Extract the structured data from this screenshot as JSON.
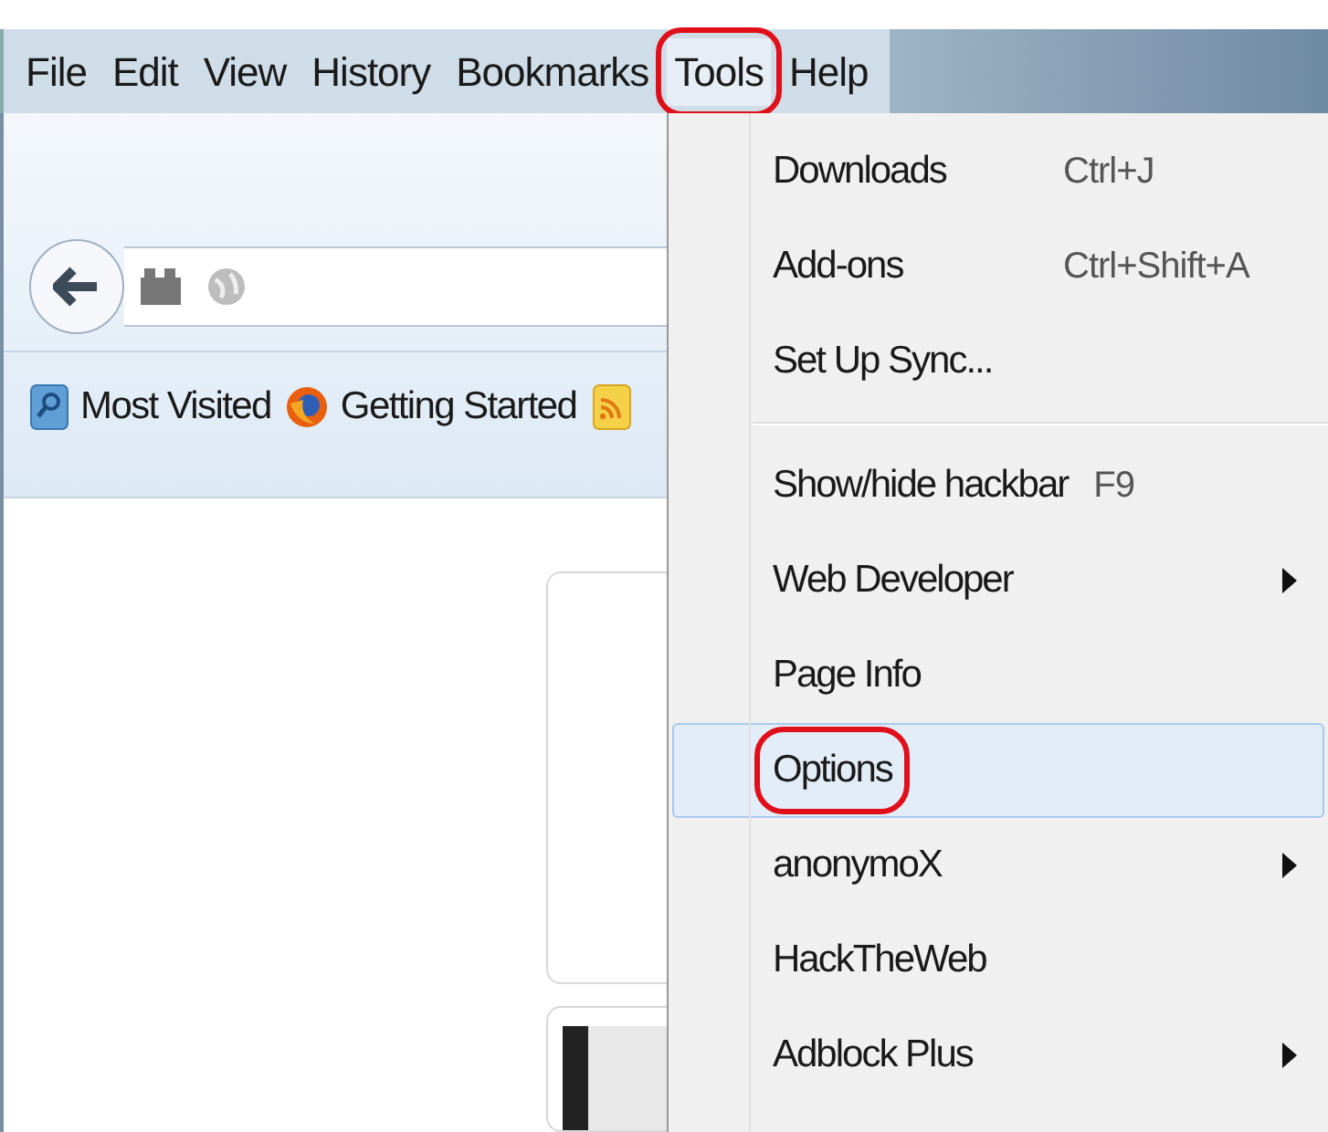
{
  "menu_bar": [
    {
      "label": "File",
      "selected": false,
      "circled": false
    },
    {
      "label": "Edit",
      "selected": false,
      "circled": false
    },
    {
      "label": "View",
      "selected": false,
      "circled": false
    },
    {
      "label": "History",
      "selected": false,
      "circled": false
    },
    {
      "label": "Bookmarks",
      "selected": false,
      "circled": false
    },
    {
      "label": "Tools",
      "selected": true,
      "circled": true
    },
    {
      "label": "Help",
      "selected": false,
      "circled": false
    }
  ],
  "bookmarks_bar": [
    {
      "kind": "folder",
      "label": "Most Visited"
    },
    {
      "kind": "firefox",
      "label": "Getting Started"
    },
    {
      "kind": "feed"
    }
  ],
  "tools_menu": [
    {
      "kind": "item",
      "label": "Downloads",
      "shortcut": "Ctrl+J",
      "submenu": false,
      "selected": false,
      "circled": false
    },
    {
      "kind": "item",
      "label": "Add-ons",
      "shortcut": "Ctrl+Shift+A",
      "submenu": false,
      "selected": false,
      "circled": false
    },
    {
      "kind": "item",
      "label": "Set Up Sync...",
      "submenu": false,
      "selected": false,
      "circled": false
    },
    {
      "kind": "separator"
    },
    {
      "kind": "item",
      "label": "Show/hide hackbar",
      "shortcut": "F9",
      "submenu": false,
      "selected": false,
      "circled": false
    },
    {
      "kind": "item",
      "label": "Web Developer",
      "submenu": true,
      "selected": false,
      "circled": false
    },
    {
      "kind": "item",
      "label": "Page Info",
      "submenu": false,
      "selected": false,
      "circled": false
    },
    {
      "kind": "item",
      "label": "Options",
      "submenu": false,
      "selected": true,
      "circled": true
    },
    {
      "kind": "item",
      "label": "anonymoX",
      "submenu": true,
      "selected": false,
      "circled": false
    },
    {
      "kind": "item",
      "label": "HackTheWeb",
      "submenu": false,
      "selected": false,
      "circled": false
    },
    {
      "kind": "item",
      "label": "Adblock Plus",
      "submenu": true,
      "selected": false,
      "circled": false
    }
  ]
}
